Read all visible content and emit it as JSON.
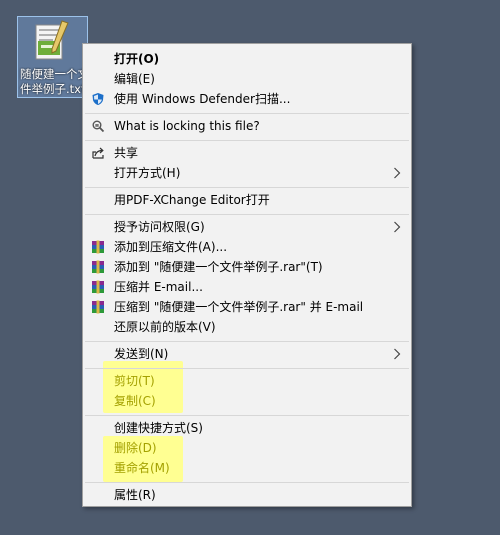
{
  "desktop": {
    "file_name_line1": "随便建一个文",
    "file_name_line2": "件举例子.txt"
  },
  "menu": {
    "open": "打开(O)",
    "edit": "编辑(E)",
    "defender_scan": "使用 Windows Defender扫描...",
    "locking": "What is locking this file?",
    "share": "共享",
    "open_with": "打开方式(H)",
    "pdf_xchange": "用PDF-XChange Editor打开",
    "grant_access": "授予访问权限(G)",
    "add_archive": "添加到压缩文件(A)...",
    "add_to_rar": "添加到 \"随便建一个文件举例子.rar\"(T)",
    "compress_email": "压缩并 E-mail...",
    "compress_rar_email": "压缩到 \"随便建一个文件举例子.rar\" 并 E-mail",
    "restore_versions": "还原以前的版本(V)",
    "send_to": "发送到(N)",
    "cut": "剪切(T)",
    "copy": "复制(C)",
    "create_shortcut": "创建快捷方式(S)",
    "delete": "删除(D)",
    "rename": "重命名(M)",
    "properties": "属性(R)"
  },
  "colors": {
    "desktop_bg": "#4d5a6d",
    "menu_bg": "#f2f2f2",
    "highlight": "#ffff8c"
  }
}
